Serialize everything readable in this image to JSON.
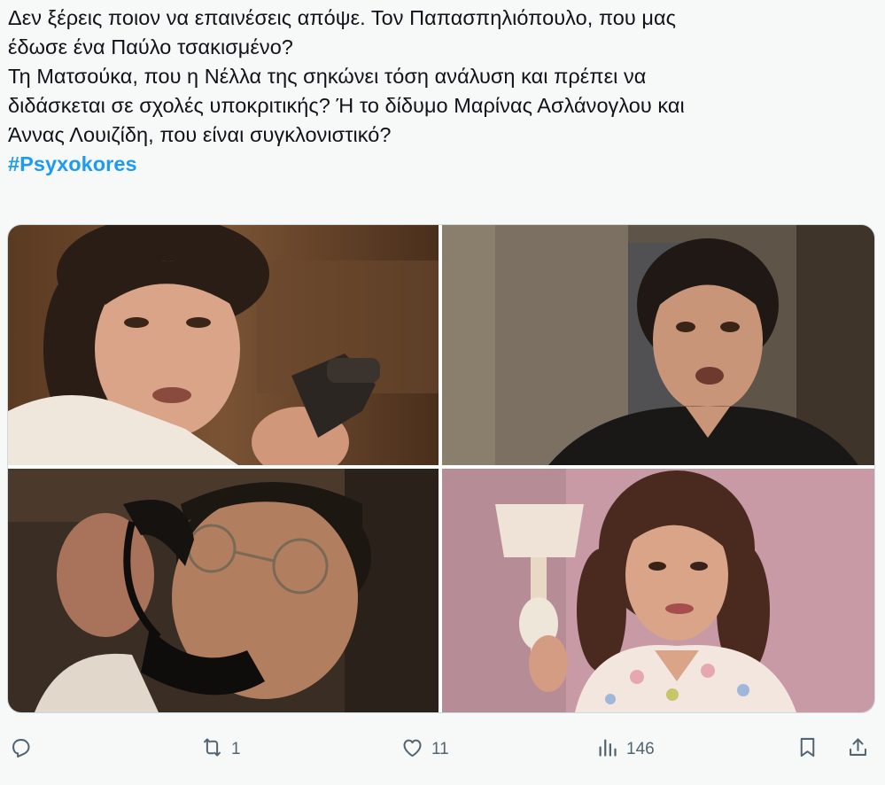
{
  "tweet": {
    "lines": [
      "Δεν ξέρεις ποιον να επαινέσεις απόψε. Τον Παπασπηλιόπουλο, που μας",
      "έδωσε ένα Παύλο τσακισμένο?",
      "Τη Ματσούκα, που η Νέλλα της σηκώνει τόση ανάλυση και πρέπει να",
      "διδάσκεται σε σχολές υποκριτικής? Ή το δίδυμο Μαρίνας Ασλάνογλου και",
      "Άννας Λουιζίδη, που είναι συγκλονιστικό?"
    ],
    "hashtag": "#Psyxokores"
  },
  "media": [
    {
      "subject": "woman holding telephone receiver, warm brown room"
    },
    {
      "subject": "shocked dark-haired woman in black dress"
    },
    {
      "subject": "man with glasses speaking into black telephone"
    },
    {
      "subject": "smiling woman in floral blouse, pink wall with lamp"
    }
  ],
  "actions": {
    "reply": {
      "icon": "reply-icon",
      "count": ""
    },
    "retweet": {
      "icon": "retweet-icon",
      "count": "1"
    },
    "like": {
      "icon": "heart-icon",
      "count": "11"
    },
    "views": {
      "icon": "views-icon",
      "count": "146"
    },
    "bookmark": {
      "icon": "bookmark-icon",
      "count": ""
    },
    "share": {
      "icon": "share-icon",
      "count": ""
    }
  },
  "colors": {
    "hashtag": "#1d9bf0",
    "text": "#0f1419",
    "muted": "#536471",
    "background": "#f7f9f9"
  }
}
